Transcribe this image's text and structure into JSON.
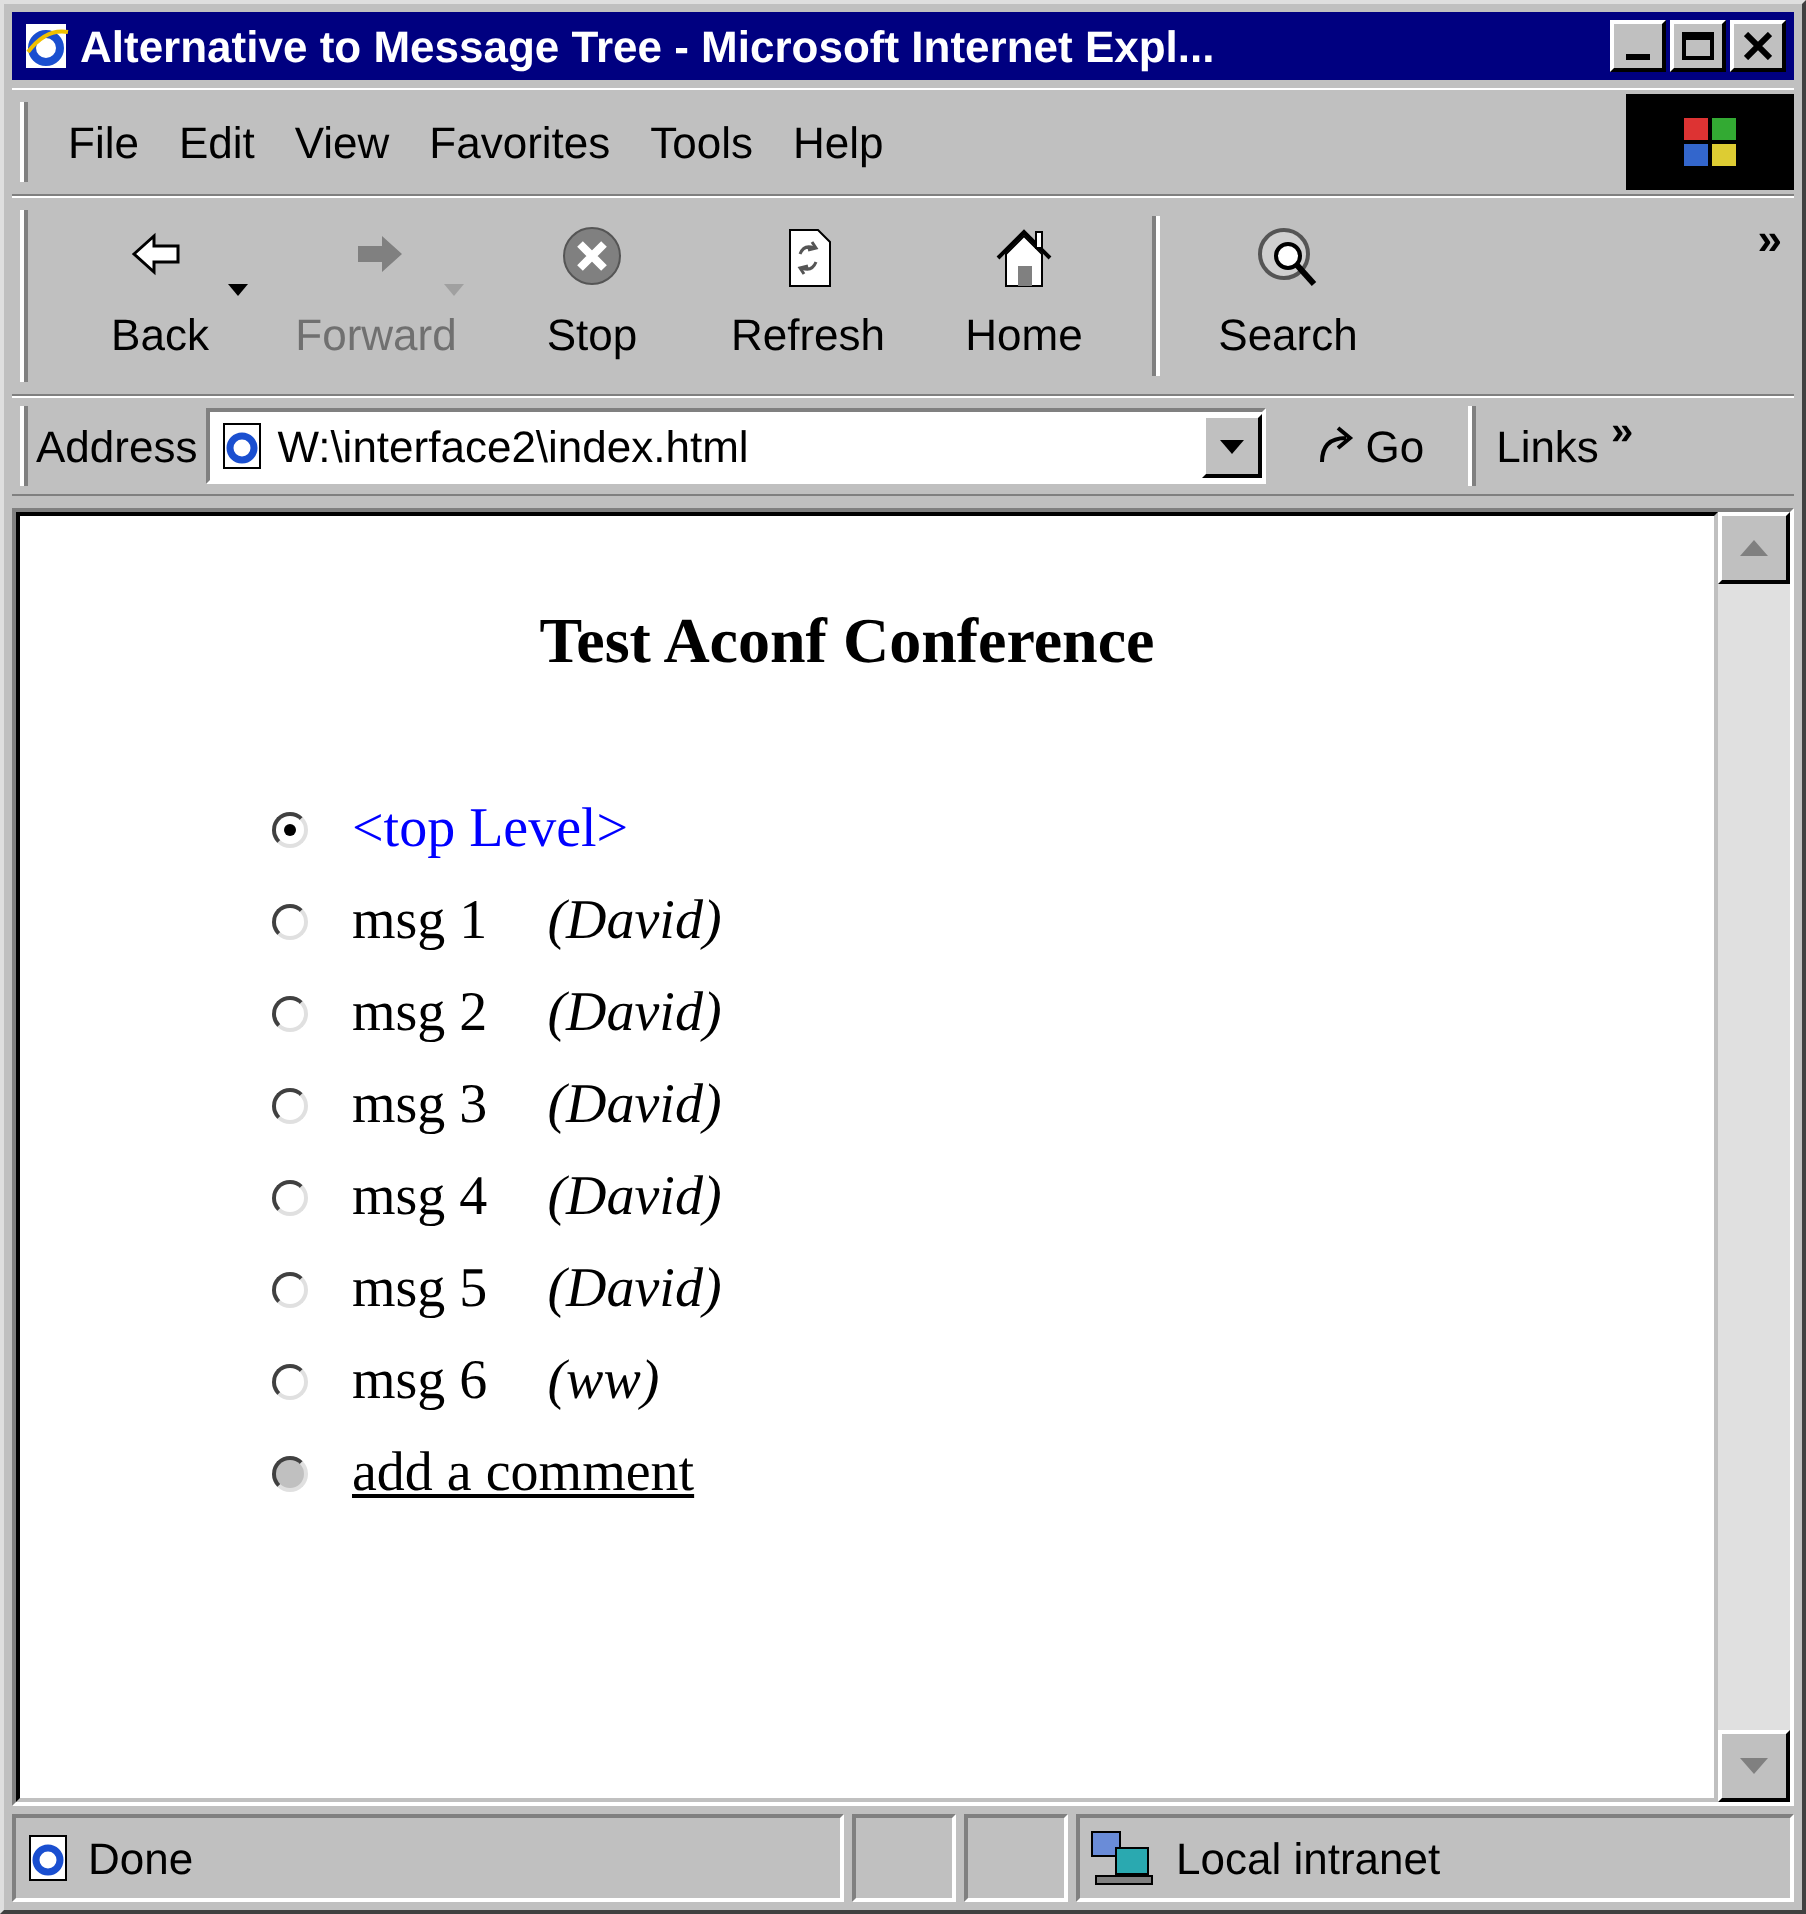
{
  "window": {
    "title": "Alternative to Message Tree - Microsoft Internet Expl..."
  },
  "menu": [
    "File",
    "Edit",
    "View",
    "Favorites",
    "Tools",
    "Help"
  ],
  "toolbar": [
    {
      "label": "Back",
      "kind": "back",
      "disabled": false,
      "dropdown": true
    },
    {
      "label": "Forward",
      "kind": "forward",
      "disabled": true,
      "dropdown": true
    },
    {
      "label": "Stop",
      "kind": "stop",
      "disabled": false,
      "dropdown": false
    },
    {
      "label": "Refresh",
      "kind": "refresh",
      "disabled": false,
      "dropdown": false
    },
    {
      "label": "Home",
      "kind": "home",
      "disabled": false,
      "dropdown": false
    },
    {
      "label": "Search",
      "kind": "search",
      "disabled": false,
      "dropdown": false
    }
  ],
  "toolbar_more": "»",
  "address": {
    "label": "Address",
    "value": "W:\\interface2\\index.html",
    "go": "Go",
    "links": "Links",
    "links_more": "»"
  },
  "page": {
    "heading": "Test Aconf Conference",
    "items": [
      {
        "kind": "link",
        "label": "<top Level>",
        "selected": true,
        "disabled": false
      },
      {
        "kind": "message",
        "label": "msg 1",
        "author": "(David)",
        "selected": false,
        "disabled": false
      },
      {
        "kind": "message",
        "label": "msg 2",
        "author": "(David)",
        "selected": false,
        "disabled": false
      },
      {
        "kind": "message",
        "label": "msg 3",
        "author": "(David)",
        "selected": false,
        "disabled": false
      },
      {
        "kind": "message",
        "label": "msg 4",
        "author": "(David)",
        "selected": false,
        "disabled": false
      },
      {
        "kind": "message",
        "label": "msg 5",
        "author": "(David)",
        "selected": false,
        "disabled": false
      },
      {
        "kind": "message",
        "label": "msg 6",
        "author": "(ww)",
        "selected": false,
        "disabled": false
      },
      {
        "kind": "action",
        "label": "add a comment",
        "selected": false,
        "disabled": true
      }
    ]
  },
  "status_bar": {
    "text": "Done",
    "zone": "Local intranet"
  }
}
